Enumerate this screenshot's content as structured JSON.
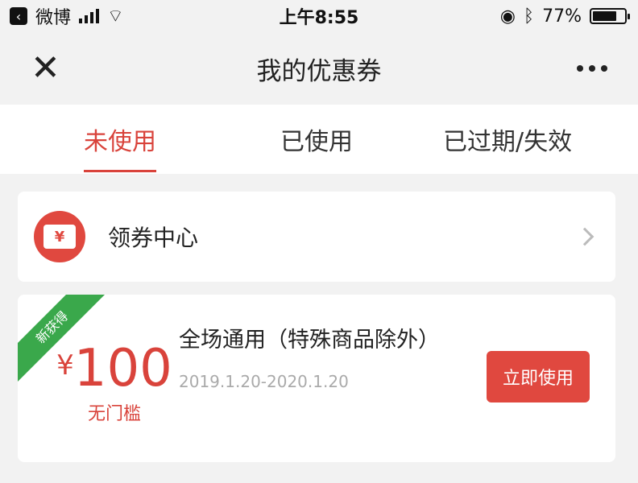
{
  "status_bar": {
    "back_app": "微博",
    "time": "上午8:55",
    "battery_text": "77%",
    "battery_level": 0.77
  },
  "nav": {
    "title": "我的优惠券",
    "close_glyph": "✕"
  },
  "tabs": [
    {
      "label": "未使用",
      "active": true
    },
    {
      "label": "已使用",
      "active": false
    },
    {
      "label": "已过期/失效",
      "active": false
    }
  ],
  "coupon_center": {
    "icon_symbol": "¥",
    "label": "领券中心",
    "icon": "ticket-icon"
  },
  "coupon": {
    "ribbon": "新获得",
    "currency": "¥",
    "amount": "100",
    "threshold": "无门槛",
    "title": "全场通用（特殊商品除外）",
    "date_range": "2019.1.20-2020.1.20",
    "button_label": "立即使用"
  },
  "colors": {
    "accent": "#d9433b",
    "ribbon": "#3aa84b",
    "background": "#f2f2f2"
  }
}
